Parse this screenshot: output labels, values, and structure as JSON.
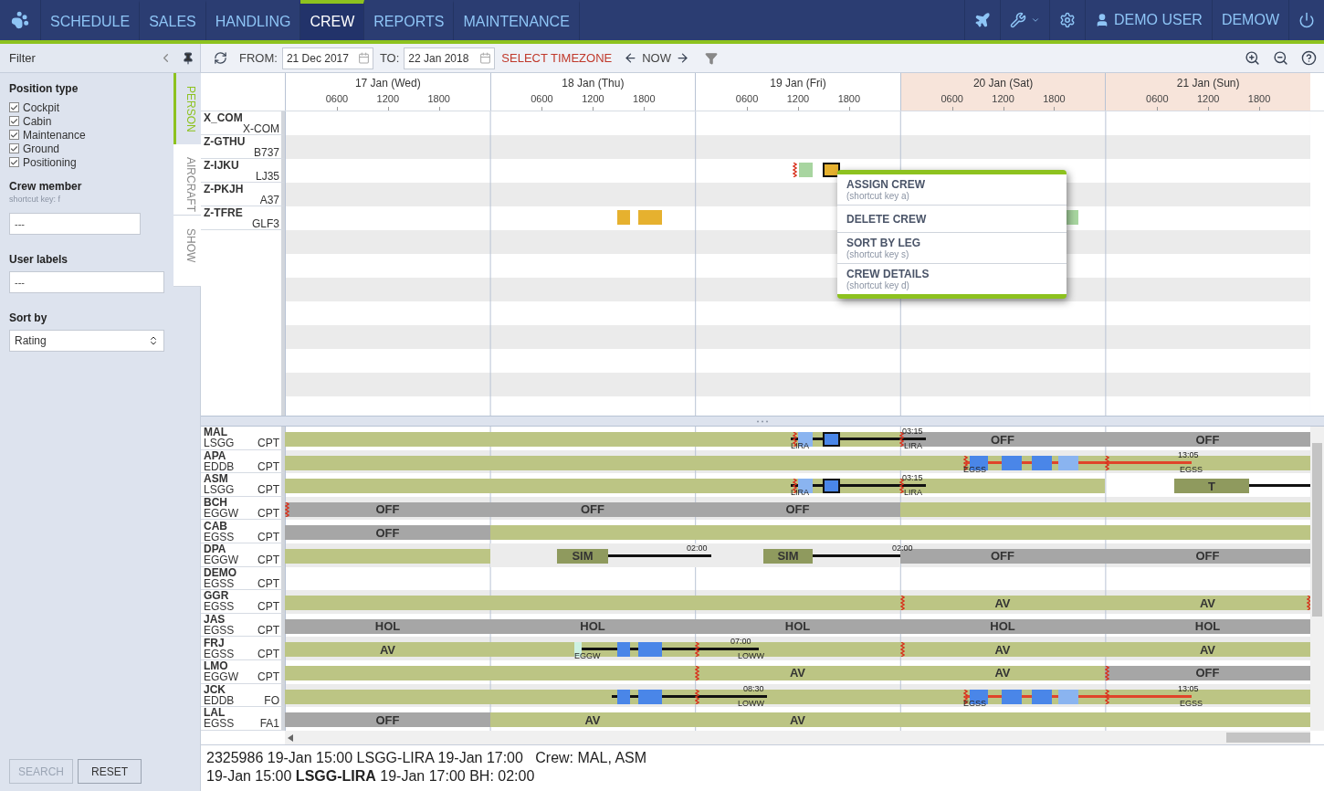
{
  "nav": {
    "items": [
      {
        "label": "SCHEDULE",
        "selected": false
      },
      {
        "label": "SALES",
        "selected": false
      },
      {
        "label": "HANDLING",
        "selected": false
      },
      {
        "label": "CREW",
        "selected": true
      },
      {
        "label": "REPORTS",
        "selected": false
      },
      {
        "label": "MAINTENANCE",
        "selected": false
      }
    ],
    "user": "DEMO USER",
    "account": "DEMOW"
  },
  "filter": {
    "title": "Filter",
    "position_type": {
      "title": "Position type",
      "options": [
        {
          "label": "Cockpit",
          "checked": true
        },
        {
          "label": "Cabin",
          "checked": true
        },
        {
          "label": "Maintenance",
          "checked": true
        },
        {
          "label": "Ground",
          "checked": true
        },
        {
          "label": "Positioning",
          "checked": true
        }
      ]
    },
    "crew_member": {
      "title": "Crew member",
      "hint": "shortcut key: f",
      "placeholder": "---"
    },
    "user_labels": {
      "title": "User labels",
      "placeholder": "---"
    },
    "sort_by": {
      "title": "Sort by",
      "value": "Rating"
    },
    "buttons": [
      {
        "label": "SEARCH",
        "disabled": true
      },
      {
        "label": "RESET",
        "disabled": false
      }
    ]
  },
  "side_tabs": [
    {
      "label": "PERSON",
      "selected": true
    },
    {
      "label": "AIRCRAFT",
      "selected": false
    },
    {
      "label": "SHOW",
      "selected": false
    }
  ],
  "toolbar": {
    "from_label": "FROM:",
    "from": "21 Dec 2017",
    "to_label": "TO:",
    "to": "22 Jan 2018",
    "timezone": "SELECT TIMEZONE",
    "now": "NOW"
  },
  "timeline": {
    "days": [
      {
        "label": "17 Jan (Wed)",
        "weekend": false,
        "hours": [
          "0600",
          "1200",
          "1800"
        ]
      },
      {
        "label": "18 Jan (Thu)",
        "weekend": false,
        "hours": [
          "0600",
          "1200",
          "1800"
        ]
      },
      {
        "label": "19 Jan (Fri)",
        "weekend": false,
        "hours": [
          "0600",
          "1200",
          "1800"
        ]
      },
      {
        "label": "20 Jan (Sat)",
        "weekend": true,
        "hours": [
          "0600",
          "1200",
          "1800"
        ]
      },
      {
        "label": "21 Jan (Sun)",
        "weekend": true,
        "hours": [
          "0600",
          "1200",
          "1800"
        ]
      }
    ]
  },
  "aircraft": [
    {
      "registration": "X_COM",
      "type": "X-COM"
    },
    {
      "registration": "Z-GTHU",
      "type": "B737"
    },
    {
      "registration": "Z-IJKU",
      "type": "LJ35",
      "events": [
        {
          "kind": "marker"
        },
        {
          "kind": "done"
        },
        {
          "kind": "pending-selected"
        }
      ]
    },
    {
      "registration": "Z-PKJH",
      "type": "A37"
    },
    {
      "registration": "Z-TFRE",
      "type": "GLF3",
      "events": [
        {
          "kind": "pending"
        },
        {
          "kind": "pending"
        },
        {
          "kind": "done"
        }
      ]
    }
  ],
  "context_menu": [
    {
      "label": "ASSIGN CREW",
      "hint": "(shortcut key a)"
    },
    {
      "label": "DELETE CREW"
    },
    {
      "label": "SORT BY LEG",
      "hint": "(shortcut key s)"
    },
    {
      "label": "CREW DETAILS",
      "hint": "(shortcut key d)"
    }
  ],
  "crew": [
    {
      "code": "MAL",
      "base": "LSGG",
      "position": "CPT",
      "events": [
        {
          "kind": "duty"
        },
        {
          "kind": "off",
          "label": "OFF"
        },
        {
          "kind": "off",
          "label": "OFF"
        },
        {
          "kind": "line"
        },
        {
          "kind": "marker"
        },
        {
          "kind": "flight-light"
        },
        {
          "kind": "flight-selected"
        },
        {
          "kind": "marker"
        },
        {
          "kind": "note-below",
          "label": "LIRA"
        },
        {
          "kind": "note-below",
          "label": "LIRA"
        },
        {
          "kind": "note-above",
          "label": "03:15"
        }
      ]
    },
    {
      "code": "APA",
      "base": "EDDB",
      "position": "CPT",
      "events": [
        {
          "kind": "duty"
        },
        {
          "kind": "route"
        },
        {
          "kind": "marker"
        },
        {
          "kind": "flight"
        },
        {
          "kind": "flight"
        },
        {
          "kind": "flight"
        },
        {
          "kind": "flight-light"
        },
        {
          "kind": "marker"
        },
        {
          "kind": "note-below",
          "label": "EGSS"
        },
        {
          "kind": "note-above",
          "label": "13:05"
        },
        {
          "kind": "note-below",
          "label": "EGSS"
        }
      ]
    },
    {
      "code": "ASM",
      "base": "LSGG",
      "position": "CPT",
      "events": [
        {
          "kind": "duty"
        },
        {
          "kind": "sim",
          "label": "T"
        },
        {
          "kind": "line"
        },
        {
          "kind": "line"
        },
        {
          "kind": "marker"
        },
        {
          "kind": "flight-light"
        },
        {
          "kind": "flight-selected"
        },
        {
          "kind": "marker"
        },
        {
          "kind": "note-below",
          "label": "LIRA"
        },
        {
          "kind": "note-below",
          "label": "LIRA"
        },
        {
          "kind": "note-above",
          "label": "03:15"
        }
      ]
    },
    {
      "code": "BCH",
      "base": "EGGW",
      "position": "CPT",
      "events": [
        {
          "kind": "off",
          "label": "OFF"
        },
        {
          "kind": "off",
          "label": "OFF"
        },
        {
          "kind": "off",
          "label": "OFF"
        },
        {
          "kind": "duty"
        },
        {
          "kind": "marker"
        }
      ]
    },
    {
      "code": "CAB",
      "base": "EGSS",
      "position": "CPT",
      "events": [
        {
          "kind": "off",
          "label": "OFF"
        },
        {
          "kind": "duty"
        }
      ]
    },
    {
      "code": "DPA",
      "base": "EGGW",
      "position": "CPT",
      "events": [
        {
          "kind": "duty"
        },
        {
          "kind": "blank"
        },
        {
          "kind": "sim",
          "label": "SIM"
        },
        {
          "kind": "line"
        },
        {
          "kind": "note-above",
          "label": "02:00"
        },
        {
          "kind": "sim",
          "label": "SIM"
        },
        {
          "kind": "line"
        },
        {
          "kind": "note-above",
          "label": "02:00"
        },
        {
          "kind": "off",
          "label": "OFF"
        },
        {
          "kind": "off",
          "label": "OFF"
        }
      ]
    },
    {
      "code": "DEMO",
      "base": "EGSS",
      "position": "CPT"
    },
    {
      "code": "GGR",
      "base": "EGSS",
      "position": "CPT",
      "events": [
        {
          "kind": "duty"
        },
        {
          "kind": "duty",
          "label": "AV"
        },
        {
          "kind": "duty",
          "label": "AV"
        },
        {
          "kind": "marker"
        },
        {
          "kind": "marker"
        }
      ]
    },
    {
      "code": "JAS",
      "base": "EGSS",
      "position": "CPT",
      "events": [
        {
          "kind": "off",
          "label": "HOL"
        },
        {
          "kind": "off",
          "label": "HOL"
        },
        {
          "kind": "off",
          "label": "HOL"
        },
        {
          "kind": "off",
          "label": "HOL"
        },
        {
          "kind": "off",
          "label": "HOL"
        }
      ]
    },
    {
      "code": "FRJ",
      "base": "EGSS",
      "position": "CPT",
      "events": [
        {
          "kind": "duty",
          "label": "AV"
        },
        {
          "kind": "duty"
        },
        {
          "kind": "duty",
          "label": "AV"
        },
        {
          "kind": "duty",
          "label": "AV"
        },
        {
          "kind": "check"
        },
        {
          "kind": "line"
        },
        {
          "kind": "flight"
        },
        {
          "kind": "flight"
        },
        {
          "kind": "marker"
        },
        {
          "kind": "marker"
        },
        {
          "kind": "note-below",
          "label": "EGGW"
        },
        {
          "kind": "note-above",
          "label": "07:00"
        },
        {
          "kind": "note-below",
          "label": "LOWW"
        }
      ]
    },
    {
      "code": "LMO",
      "base": "EGGW",
      "position": "CPT",
      "events": [
        {
          "kind": "duty"
        },
        {
          "kind": "duty",
          "label": "AV"
        },
        {
          "kind": "duty",
          "label": "AV"
        },
        {
          "kind": "off",
          "label": "OFF"
        },
        {
          "kind": "marker"
        },
        {
          "kind": "marker"
        }
      ]
    },
    {
      "code": "JCK",
      "base": "EDDB",
      "position": "FO",
      "events": [
        {
          "kind": "duty"
        },
        {
          "kind": "line"
        },
        {
          "kind": "flight"
        },
        {
          "kind": "flight"
        },
        {
          "kind": "marker"
        },
        {
          "kind": "note-below",
          "label": "LOWW"
        },
        {
          "kind": "note-above",
          "label": "08:30"
        },
        {
          "kind": "route"
        },
        {
          "kind": "marker"
        },
        {
          "kind": "flight"
        },
        {
          "kind": "flight"
        },
        {
          "kind": "flight"
        },
        {
          "kind": "flight-light"
        },
        {
          "kind": "marker"
        },
        {
          "kind": "note-below",
          "label": "EGSS"
        },
        {
          "kind": "note-above",
          "label": "13:05"
        },
        {
          "kind": "note-below",
          "label": "EGSS"
        }
      ]
    },
    {
      "code": "LAL",
      "base": "EGSS",
      "position": "FA1",
      "events": [
        {
          "kind": "off",
          "label": "OFF"
        },
        {
          "kind": "duty",
          "label": "AV"
        },
        {
          "kind": "duty",
          "label": "AV"
        },
        {
          "kind": "duty"
        }
      ]
    }
  ],
  "status": {
    "lines": [
      "2325986 19-Jan 15:00 LSGG-LIRA 19-Jan 17:00   Crew: MAL, ASM",
      "19-Jan 15:00 **LSGG-LIRA** 19-Jan 17:00 BH: 02:00"
    ]
  }
}
